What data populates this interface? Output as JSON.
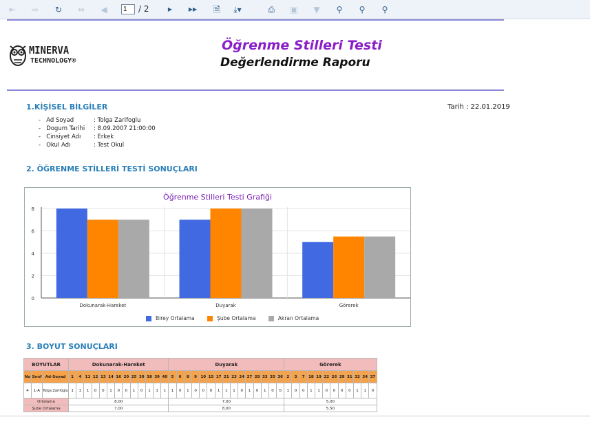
{
  "toolbar": {
    "page_current": "1",
    "page_total": "/ 2",
    "icons": [
      "first-page-icon",
      "prev-page-icon",
      "refresh-icon",
      "back-icon",
      "prev-icon",
      "next-icon",
      "last-page-icon",
      "document-icon",
      "export-icon",
      "print-icon",
      "page-setup-icon",
      "filter-icon",
      "search-icon",
      "zoom-out-icon",
      "zoom-in-icon"
    ]
  },
  "report": {
    "logo_name": "MINERVA",
    "logo_sub": "TECHNOLOGY®",
    "title": "Öğrenme Stilleri Testi",
    "subtitle": "Değerlendirme Raporu",
    "date": "Tarih : 22.01.2019",
    "sections": {
      "personal": "1.KİŞİSEL BİLGİLER",
      "results": "2. ÖĞRENME STİLLERİ TESTİ SONUÇLARI",
      "dimensions": "3. BOYUT SONUÇLARI"
    },
    "personal": [
      {
        "label": "Ad Soyad",
        "value": ": Tolga Zarifoglu"
      },
      {
        "label": "Dogum Tarihi",
        "value": ": 8.09.2007 21:00:00"
      },
      {
        "label": "Cinsiyet Adı",
        "value": ": Erkek"
      },
      {
        "label": "Okul Adı",
        "value": ": Test Okul"
      }
    ]
  },
  "chart_data": {
    "type": "bar",
    "title": "Öğrenme Stilleri Testi Grafiği",
    "categories": [
      "Dokunarak-Hareket",
      "Duyarak",
      "Görerek"
    ],
    "series": [
      {
        "name": "Birey Ortalama",
        "values": [
          8,
          7,
          5
        ],
        "color": "#4169e1"
      },
      {
        "name": "Şube Ortalama",
        "values": [
          7,
          8,
          5.5
        ],
        "color": "#ff8500"
      },
      {
        "name": "Akran Ortalama",
        "values": [
          7,
          8,
          5.5
        ],
        "color": "#a9a9a9"
      }
    ],
    "yticks": [
      "0",
      "2",
      "4",
      "6",
      "8"
    ],
    "ylim": [
      0,
      8
    ],
    "legend": "bottom"
  },
  "table": {
    "header_boyutlar": "BOYUTLAR",
    "groups": [
      "Dokunarak-Hareket",
      "Duyarak",
      "Görerek"
    ],
    "id_cols": [
      "No",
      "Sınıf",
      "Ad-Soyad"
    ],
    "questions": [
      [
        "1",
        "4",
        "11",
        "12",
        "13",
        "14",
        "16",
        "20",
        "25",
        "30",
        "38",
        "39",
        "40"
      ],
      [
        "5",
        "6",
        "8",
        "9",
        "10",
        "15",
        "17",
        "21",
        "23",
        "24",
        "27",
        "28",
        "33",
        "35",
        "36"
      ],
      [
        "2",
        "3",
        "7",
        "18",
        "19",
        "22",
        "26",
        "29",
        "31",
        "32",
        "34",
        "37"
      ]
    ],
    "row": {
      "no": "4",
      "sinif": "1-A",
      "name": "Tolga Zarifoglu",
      "answers": [
        [
          "1",
          "1",
          "1",
          "0",
          "0",
          "1",
          "0",
          "0",
          "1",
          "0",
          "1",
          "1",
          "1"
        ],
        [
          "1",
          "0",
          "1",
          "0",
          "0",
          "0",
          "1",
          "1",
          "1",
          "0",
          "1",
          "0",
          "1",
          "0",
          "0"
        ],
        [
          "1",
          "0",
          "0",
          "1",
          "1",
          "0",
          "0",
          "0",
          "0",
          "1",
          "1",
          "0",
          "1"
        ]
      ]
    },
    "averages": [
      {
        "label": "Ortalama",
        "values": [
          "8,00",
          "7,00",
          "5,00"
        ]
      },
      {
        "label": "Şube Ortalama",
        "values": [
          "7,00",
          "8,00",
          "5,50"
        ]
      }
    ]
  }
}
